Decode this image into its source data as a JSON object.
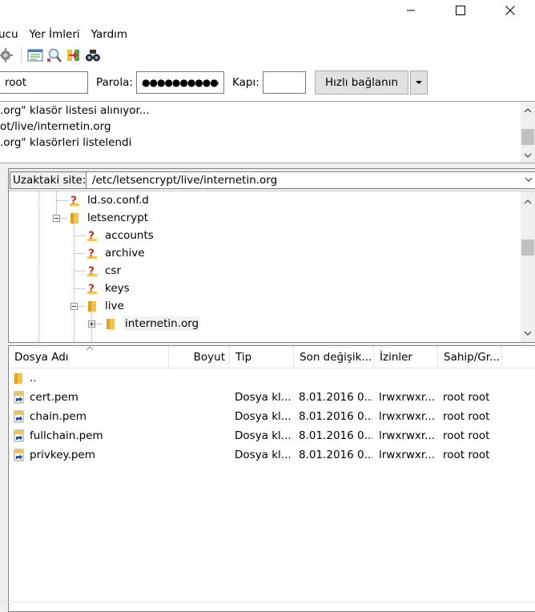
{
  "window": {
    "controls": [
      "minimize",
      "maximize",
      "close"
    ]
  },
  "menu": {
    "items": [
      "ucu",
      "Yer İmleri",
      "Yardım"
    ]
  },
  "toolbar": {
    "icons": [
      "process-queue-icon",
      "toggle-message-log-icon",
      "search-remote-icon",
      "compare-dirs-icon",
      "find-files-icon"
    ]
  },
  "quickconnect": {
    "username_value": "root",
    "password_label": "Parola:",
    "password_value": "●●●●●●●●●●●",
    "port_label": "Kapı:",
    "port_value": "",
    "connect_label": "Hızlı bağlanın"
  },
  "log": {
    "lines": [
      ".org\" klasör listesi alınıyor...",
      "ot/live/internetin.org",
      ".org\" klasörleri listelendi"
    ]
  },
  "remote": {
    "site_label": "Uzaktaki site:",
    "path": "/etc/letsencrypt/live/internetin.org",
    "tree": [
      {
        "label": "ld.so.conf.d",
        "type": "unknown"
      },
      {
        "label": "letsencrypt",
        "type": "folder-open"
      },
      {
        "label": "accounts",
        "type": "unknown"
      },
      {
        "label": "archive",
        "type": "unknown"
      },
      {
        "label": "csr",
        "type": "unknown"
      },
      {
        "label": "keys",
        "type": "unknown"
      },
      {
        "label": "live",
        "type": "folder-open"
      },
      {
        "label": "internetin.org",
        "type": "folder"
      }
    ]
  },
  "files": {
    "columns": [
      "Dosya Adı",
      "Boyut",
      "Tip",
      "Son değişik...",
      "İzinler",
      "Sahip/Gr..."
    ],
    "parent": "..",
    "rows": [
      {
        "name": "cert.pem",
        "size": "",
        "type": "Dosya kl...",
        "modified": "8.01.2016 0...",
        "perms": "lrwxrwxr...",
        "owner": "root root"
      },
      {
        "name": "chain.pem",
        "size": "",
        "type": "Dosya kl...",
        "modified": "8.01.2016 0...",
        "perms": "lrwxrwxr...",
        "owner": "root root"
      },
      {
        "name": "fullchain.pem",
        "size": "",
        "type": "Dosya kl...",
        "modified": "8.01.2016 0...",
        "perms": "lrwxrwxr...",
        "owner": "root root"
      },
      {
        "name": "privkey.pem",
        "size": "",
        "type": "Dosya kl...",
        "modified": "8.01.2016 0...",
        "perms": "lrwxrwxr...",
        "owner": "root root"
      }
    ]
  },
  "colors": {
    "folder": "#f4c24f",
    "folder_dark": "#d9a22a",
    "question": "#c0392b",
    "link_arrow": "#1e5aa8"
  }
}
